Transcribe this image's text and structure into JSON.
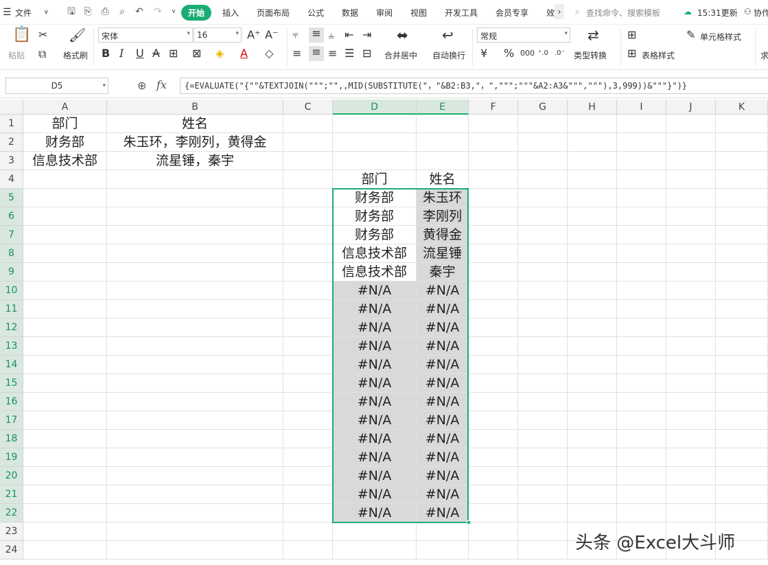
{
  "menubar": {
    "file": "文件",
    "tabs": [
      "开始",
      "插入",
      "页面布局",
      "公式",
      "数据",
      "审阅",
      "视图",
      "开发工具",
      "会员专享",
      "效"
    ],
    "active_tab": "开始",
    "search_placeholder": "查找命令、搜索模板",
    "update": "15:31更新",
    "collab": "协作",
    "accent": "#1aad73"
  },
  "ribbon": {
    "paste": "粘贴",
    "format_painter": "格式刷",
    "font_name": "宋体",
    "font_size": "16",
    "merge_center": "合并居中",
    "wrap_text": "自动换行",
    "number_format": "常规",
    "type_convert": "类型转换",
    "cell_style": "单元格样式",
    "table_style": "表格样式",
    "sum": "求",
    "currency": "¥",
    "percent": "%",
    "thousands": "000"
  },
  "formula_bar": {
    "name_box": "D5",
    "fx": "fx",
    "formula": "{=EVALUATE(\"{\"\"&TEXTJOIN(\"\"\";\"\",,MID(SUBSTITUTE(\"，\"&B2:B3,\"，\",\"\"\";\"\"\"&A2:A3&\"\"\",\"\"\"),3,999))&\"\"\"}\")}"
  },
  "columns": [
    "A",
    "B",
    "C",
    "D",
    "E",
    "F",
    "G",
    "H",
    "I",
    "J",
    "K"
  ],
  "rows": [
    "1",
    "2",
    "3",
    "4",
    "5",
    "6",
    "7",
    "8",
    "9",
    "10",
    "11",
    "12",
    "13",
    "14",
    "15",
    "16",
    "17",
    "18",
    "19",
    "20",
    "21",
    "22",
    "23",
    "24"
  ],
  "source_table": {
    "headers": [
      "部门",
      "姓名"
    ],
    "rows": [
      [
        "财务部",
        "朱玉环，李刚列，黄得金"
      ],
      [
        "信息技术部",
        "流星锤，秦宇"
      ]
    ]
  },
  "result_table": {
    "headers": [
      "部门",
      "姓名"
    ],
    "rows": [
      [
        "财务部",
        "朱玉环"
      ],
      [
        "财务部",
        "李刚列"
      ],
      [
        "财务部",
        "黄得金"
      ],
      [
        "信息技术部",
        "流星锤"
      ],
      [
        "信息技术部",
        "秦宇"
      ],
      [
        "#N/A",
        "#N/A"
      ],
      [
        "#N/A",
        "#N/A"
      ],
      [
        "#N/A",
        "#N/A"
      ],
      [
        "#N/A",
        "#N/A"
      ],
      [
        "#N/A",
        "#N/A"
      ],
      [
        "#N/A",
        "#N/A"
      ],
      [
        "#N/A",
        "#N/A"
      ],
      [
        "#N/A",
        "#N/A"
      ],
      [
        "#N/A",
        "#N/A"
      ],
      [
        "#N/A",
        "#N/A"
      ],
      [
        "#N/A",
        "#N/A"
      ],
      [
        "#N/A",
        "#N/A"
      ],
      [
        "#N/A",
        "#N/A"
      ]
    ]
  },
  "watermark": "头条 @Excel大斗师"
}
